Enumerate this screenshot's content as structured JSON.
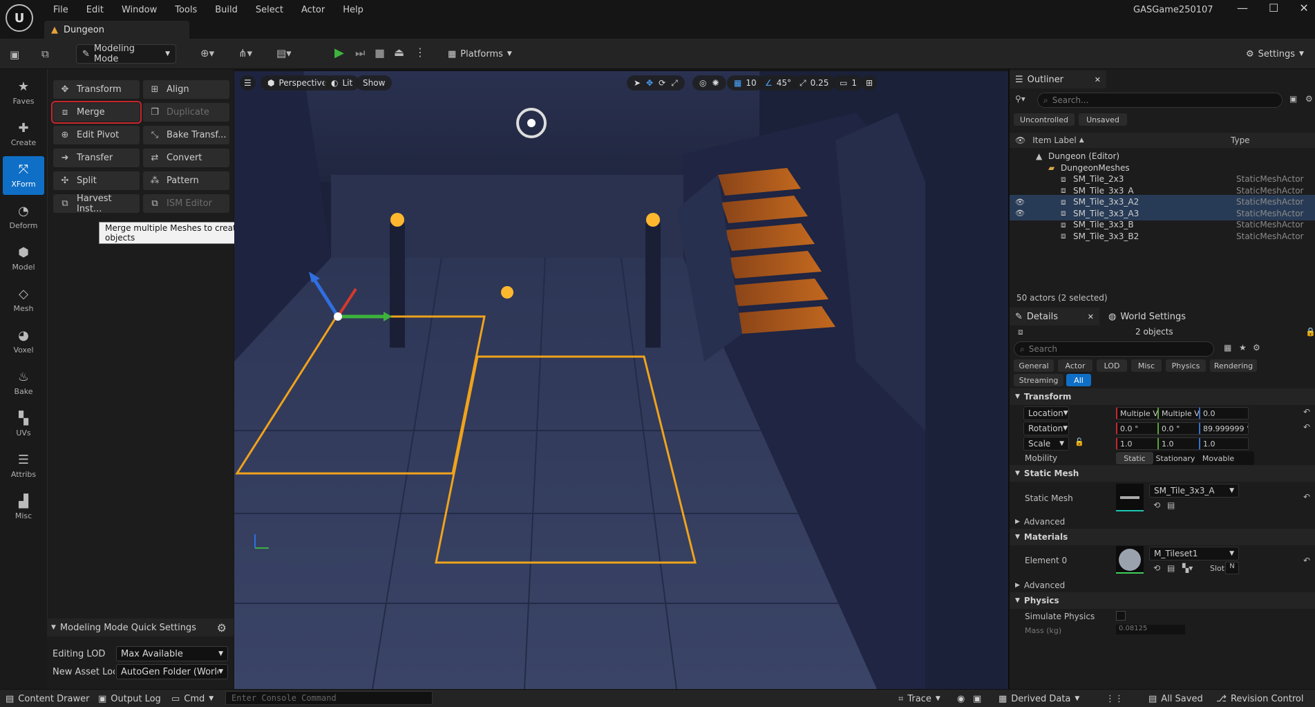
{
  "menu": [
    "File",
    "Edit",
    "Window",
    "Tools",
    "Build",
    "Select",
    "Actor",
    "Help"
  ],
  "project_name": "GASGame250107",
  "doc_tab": "Dungeon",
  "toolbar": {
    "mode_label": "Modeling Mode",
    "platforms_label": "Platforms",
    "settings_label": "Settings"
  },
  "palette": [
    {
      "label": "Faves",
      "icon": "star-icon"
    },
    {
      "label": "Create",
      "icon": "create-icon"
    },
    {
      "label": "XForm",
      "icon": "xform-icon",
      "active": true
    },
    {
      "label": "Deform",
      "icon": "deform-icon"
    },
    {
      "label": "Model",
      "icon": "model-icon"
    },
    {
      "label": "Mesh",
      "icon": "mesh-icon"
    },
    {
      "label": "Voxel",
      "icon": "voxel-icon"
    },
    {
      "label": "Bake",
      "icon": "bake-icon"
    },
    {
      "label": "UVs",
      "icon": "uvs-icon"
    },
    {
      "label": "Attribs",
      "icon": "attribs-icon"
    },
    {
      "label": "Misc",
      "icon": "misc-icon"
    }
  ],
  "tools": [
    {
      "label": "Transform",
      "enabled": true
    },
    {
      "label": "Align",
      "enabled": true
    },
    {
      "label": "Merge",
      "enabled": true,
      "highlighted": true
    },
    {
      "label": "Duplicate",
      "enabled": false
    },
    {
      "label": "Edit Pivot",
      "enabled": true
    },
    {
      "label": "Bake Transf...",
      "enabled": true
    },
    {
      "label": "Transfer",
      "enabled": true
    },
    {
      "label": "Convert",
      "enabled": true
    },
    {
      "label": "Split",
      "enabled": true
    },
    {
      "label": "Pattern",
      "enabled": true
    },
    {
      "label": "Harvest Inst...",
      "enabled": true
    },
    {
      "label": "ISM Editor",
      "enabled": false
    }
  ],
  "tooltip": "Merge multiple Meshes to create new objects",
  "quick_settings": {
    "title": "Modeling Mode Quick Settings",
    "editing_lod_label": "Editing LOD",
    "editing_lod_value": "Max Available",
    "new_asset_label": "New Asset Loc",
    "new_asset_value": "AutoGen Folder (World-"
  },
  "viewport": {
    "perspective": "Perspective",
    "lit": "Lit",
    "show": "Show",
    "grid_snap": "10",
    "rot_snap": "45°",
    "scale_snap": "0.25",
    "camera_speed": "1"
  },
  "outliner": {
    "tab": "Outliner",
    "search_placeholder": "Search...",
    "filters": [
      "Uncontrolled",
      "Unsaved"
    ],
    "col_label": "Item Label",
    "col_type": "Type",
    "rows": [
      {
        "name": "Dungeon (Editor)",
        "type": "",
        "indent": 1,
        "selected": false,
        "visible": false
      },
      {
        "name": "DungeonMeshes",
        "type": "",
        "indent": 2,
        "selected": false,
        "visible": false
      },
      {
        "name": "SM_Tile_2x3",
        "type": "StaticMeshActor",
        "indent": 3,
        "selected": false,
        "visible": false
      },
      {
        "name": "SM_Tile_3x3_A",
        "type": "StaticMeshActor",
        "indent": 3,
        "selected": false,
        "visible": false
      },
      {
        "name": "SM_Tile_3x3_A2",
        "type": "StaticMeshActor",
        "indent": 3,
        "selected": true,
        "visible": true
      },
      {
        "name": "SM_Tile_3x3_A3",
        "type": "StaticMeshActor",
        "indent": 3,
        "selected": true,
        "visible": true
      },
      {
        "name": "SM_Tile_3x3_B",
        "type": "StaticMeshActor",
        "indent": 3,
        "selected": false,
        "visible": false
      },
      {
        "name": "SM_Tile_3x3_B2",
        "type": "StaticMeshActor",
        "indent": 3,
        "selected": false,
        "visible": false
      }
    ],
    "footer": "50 actors (2 selected)"
  },
  "details": {
    "tab": "Details",
    "world_settings_tab": "World Settings",
    "objects_count": "2 objects",
    "search_placeholder": "Search",
    "categories": [
      "General",
      "Actor",
      "LOD",
      "Misc",
      "Physics",
      "Rendering",
      "Streaming",
      "All"
    ],
    "transform_title": "Transform",
    "location_label": "Location",
    "location": [
      "Multiple Va",
      "Multiple Va",
      "0.0"
    ],
    "rotation_label": "Rotation",
    "rotation": [
      "0.0 °",
      "0.0 °",
      "89.999999 °"
    ],
    "scale_label": "Scale",
    "scale": [
      "1.0",
      "1.0",
      "1.0"
    ],
    "mobility_label": "Mobility",
    "mobility_options": [
      "Static",
      "Stationary",
      "Movable"
    ],
    "static_mesh_title": "Static Mesh",
    "static_mesh_label": "Static Mesh",
    "static_mesh_value": "SM_Tile_3x3_A",
    "advanced_label": "Advanced",
    "materials_title": "Materials",
    "element_label": "Element 0",
    "material_value": "M_Tileset1",
    "slot_label": "Slot",
    "slot_value": "N",
    "physics_title": "Physics",
    "simulate_physics_label": "Simulate Physics",
    "mass_label": "Mass (kg)",
    "mass_value": "0.08125"
  },
  "statusbar": {
    "content_drawer": "Content Drawer",
    "output_log": "Output Log",
    "cmd": "Cmd",
    "console_placeholder": "Enter Console Command",
    "trace": "Trace",
    "derived_data": "Derived Data",
    "all_saved": "All Saved",
    "revision_control": "Revision Control"
  }
}
